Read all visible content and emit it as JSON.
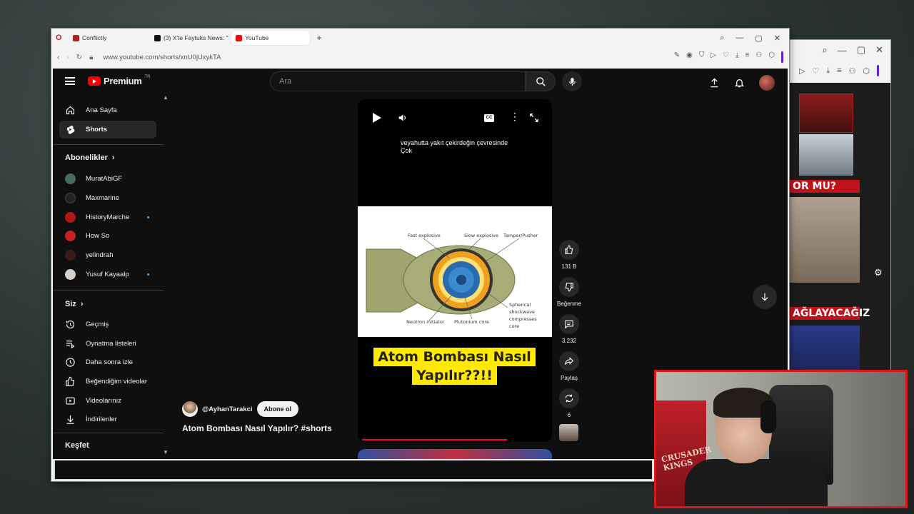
{
  "browser": {
    "tabs": [
      {
        "label": "Conflictly",
        "fav_color": "#b02020"
      },
      {
        "label": "(3) X'te Faytuks News: \"A",
        "fav_color": "#111111"
      },
      {
        "label": "YouTube",
        "fav_color": "#ff0000"
      }
    ],
    "url": "www.youtube.com/shorts/xnU0jUxykTA"
  },
  "header": {
    "logo_text": "Premium",
    "logo_region": "TR",
    "search_placeholder": "Ara"
  },
  "sidebar": {
    "main": [
      {
        "label": "Ana Sayfa",
        "icon": "home-icon"
      },
      {
        "label": "Shorts",
        "icon": "shorts-icon"
      }
    ],
    "subs_title": "Abonelikler",
    "subscriptions": [
      {
        "label": "MuratAbiGF",
        "color": "#4a6a60",
        "dot": false
      },
      {
        "label": "Maxmarine",
        "color": "#222222",
        "dot": false
      },
      {
        "label": "HistoryMarche",
        "color": "#b01818",
        "dot": true
      },
      {
        "label": "How So",
        "color": "#c82020",
        "dot": false
      },
      {
        "label": "yelindrah",
        "color": "#3a1a1a",
        "dot": false
      },
      {
        "label": "Yusuf Kayaalp",
        "color": "#d8d0c8",
        "dot": true
      }
    ],
    "you_title": "Siz",
    "you": [
      {
        "label": "Geçmiş",
        "icon": "history-icon"
      },
      {
        "label": "Oynatma listeleri",
        "icon": "playlist-icon"
      },
      {
        "label": "Daha sonra izle",
        "icon": "watch-later-icon"
      },
      {
        "label": "Beğendiğim videolar",
        "icon": "liked-icon"
      },
      {
        "label": "Videolarınız",
        "icon": "your-videos-icon"
      },
      {
        "label": "İndirilenler",
        "icon": "download-icon"
      }
    ],
    "explore_title": "Keşfet"
  },
  "short": {
    "subtitle_line1": "veyahutta yakıt çekirdeğin çevresinde",
    "subtitle_line2": "Çok",
    "diagram_labels": {
      "fast": "Fast explosive",
      "slow": "Slow explosive",
      "tamper": "Tamper/Pusher",
      "spherical": "Spherical",
      "shockwave": "shockwave",
      "compresses": "compresses",
      "core": "core",
      "neutron": "Neutron initiator",
      "plutonium": "Plutonium core"
    },
    "caption_line1": "Atom Bombası Nasıl",
    "caption_line2": "Yapılır??!!",
    "progress": 0.78
  },
  "actions": {
    "likes": "131 B",
    "dislike_label": "Beğenme",
    "comments": "3.232",
    "share_label": "Paylaş",
    "remix_count": "6"
  },
  "channel": {
    "handle": "@AyhanTarakci",
    "subscribe_label": "Abone ol",
    "video_title": "Atom Bombası Nasıl Yapılır? #shorts"
  },
  "side_window": {
    "banner1": "OR MU?",
    "banner2": "AĞLAYACAĞIZ"
  },
  "webcam": {
    "poster_text_line1": "CRUSADER",
    "poster_text_line2": "KINGS"
  }
}
